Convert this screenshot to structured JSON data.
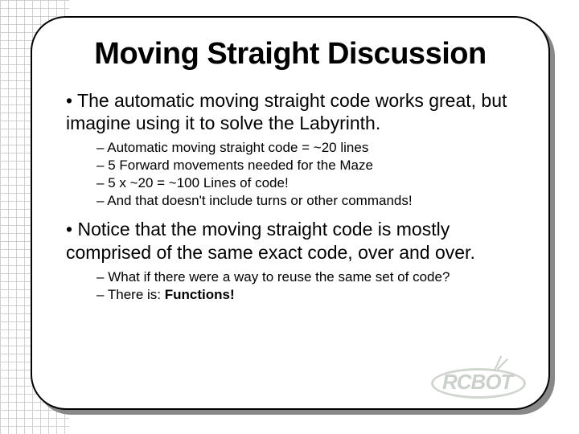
{
  "title": "Moving Straight Discussion",
  "bullets": {
    "b1": "The automatic moving straight code works great, but imagine using it to solve the Labyrinth.",
    "sub1": {
      "s1": "Automatic moving straight code = ~20 lines",
      "s2": "5 Forward movements needed for the Maze",
      "s3": "5 x ~20 = ~100 Lines of code!",
      "s4": "And that doesn't include turns or other commands!"
    },
    "b2": "Notice that the moving straight code is mostly comprised of the same exact code, over and over.",
    "sub2": {
      "s1": "What if there were a way to reuse the same set of code?",
      "s2_a": "There is: ",
      "s2_b": "Functions!"
    }
  },
  "logo_text": "RCBOT"
}
